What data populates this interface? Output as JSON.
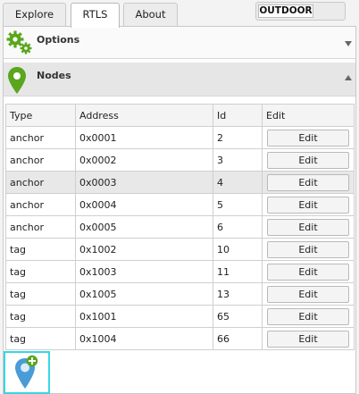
{
  "tabs": [
    {
      "label": "Explore",
      "active": false
    },
    {
      "label": "RTLS",
      "active": true
    },
    {
      "label": "About",
      "active": false
    }
  ],
  "outdoor": {
    "label": "OUTDOOR"
  },
  "sections": {
    "options": {
      "title": "Options",
      "icon": "gears-icon",
      "collapsed": true
    },
    "nodes": {
      "title": "Nodes",
      "icon": "map-pin-icon",
      "collapsed": false
    }
  },
  "table": {
    "headers": [
      "Type",
      "Address",
      "Id",
      "Edit"
    ],
    "rows": [
      {
        "type": "anchor",
        "address": "0x0001",
        "id": "2",
        "edit": "Edit"
      },
      {
        "type": "anchor",
        "address": "0x0002",
        "id": "3",
        "edit": "Edit"
      },
      {
        "type": "anchor",
        "address": "0x0003",
        "id": "4",
        "edit": "Edit",
        "selected": true
      },
      {
        "type": "anchor",
        "address": "0x0004",
        "id": "5",
        "edit": "Edit"
      },
      {
        "type": "anchor",
        "address": "0x0005",
        "id": "6",
        "edit": "Edit"
      },
      {
        "type": "tag",
        "address": "0x1002",
        "id": "10",
        "edit": "Edit"
      },
      {
        "type": "tag",
        "address": "0x1003",
        "id": "11",
        "edit": "Edit"
      },
      {
        "type": "tag",
        "address": "0x1005",
        "id": "13",
        "edit": "Edit"
      },
      {
        "type": "tag",
        "address": "0x1001",
        "id": "65",
        "edit": "Edit"
      },
      {
        "type": "tag",
        "address": "0x1004",
        "id": "66",
        "edit": "Edit"
      }
    ]
  },
  "add_node": {
    "icon": "add-location-icon"
  },
  "colors": {
    "accent_green": "#5aa61c",
    "add_button_border": "#37d6e6",
    "pin_blue": "#4a9bd6"
  }
}
